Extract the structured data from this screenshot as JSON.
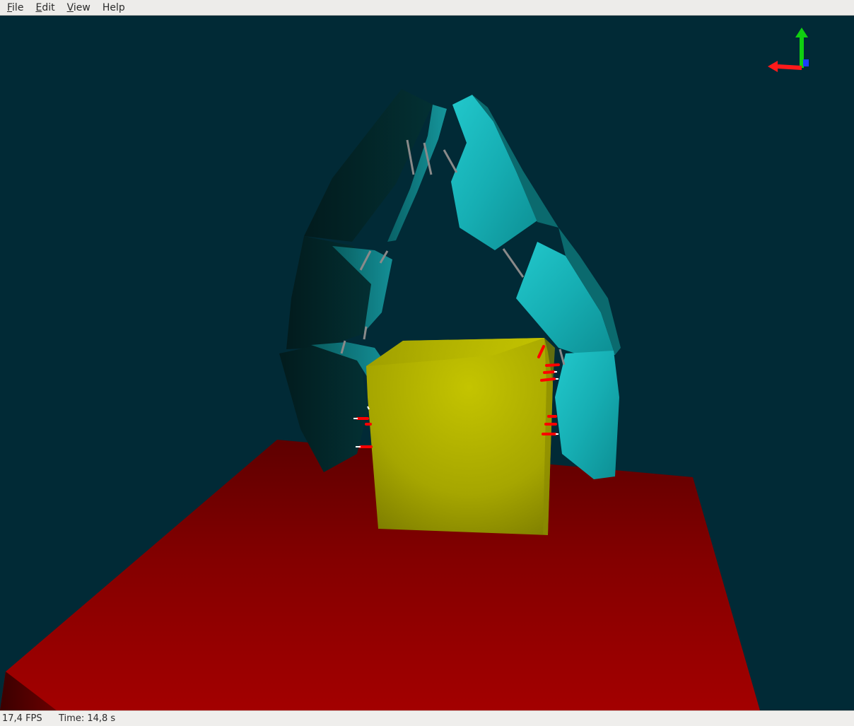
{
  "menu": {
    "file": {
      "mnemonic": "F",
      "rest": "ile"
    },
    "edit": {
      "mnemonic": "E",
      "rest": "dit"
    },
    "view": {
      "mnemonic": "V",
      "rest": "iew"
    },
    "help": {
      "label": "Help"
    }
  },
  "status": {
    "fps": "17,4 FPS",
    "time": "Time: 14,8 s"
  },
  "scene": {
    "background": "#012a36",
    "floor_color": "#9e0000",
    "cube_color": "#b8b800",
    "finger_right_color": "#19b6bb",
    "finger_left_color": "#022628",
    "axis_x_color": "#ff1a1a",
    "axis_y_color": "#10d010",
    "axis_z_color": "#1a3cff",
    "contact_marker_color": "#ff0000"
  }
}
